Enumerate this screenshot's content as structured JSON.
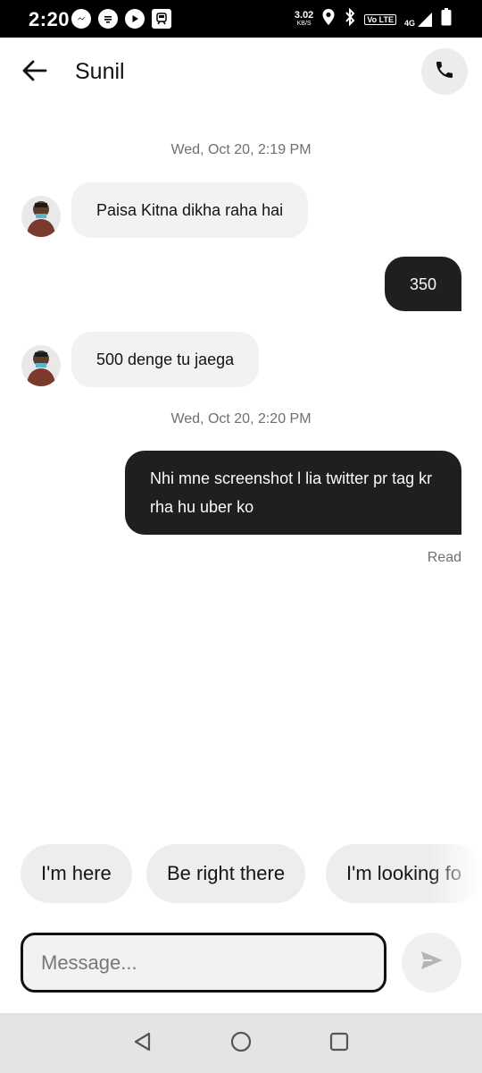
{
  "status_bar": {
    "time": "2:20",
    "speed": "3.02",
    "speed_unit": "KB/S",
    "volte": "Vo LTE",
    "network": "4G",
    "icons": [
      "messenger-icon",
      "chat-icon",
      "play-icon",
      "train-icon",
      "location-icon",
      "bluetooth-icon",
      "volte-icon",
      "signal-icon",
      "battery-icon"
    ]
  },
  "header": {
    "title": "Sunil",
    "back_icon": "arrow-left-icon",
    "call_icon": "phone-icon"
  },
  "chat": {
    "timestamp_1": "Wed, Oct 20, 2:19 PM",
    "timestamp_2": "Wed, Oct 20, 2:20 PM",
    "messages": [
      {
        "direction": "in",
        "text": "Paisa Kitna dikha raha hai"
      },
      {
        "direction": "out",
        "text": "350"
      },
      {
        "direction": "in",
        "text": "500 denge tu jaega"
      },
      {
        "direction": "out",
        "text": "Nhi mne screenshot l lia twitter pr tag kr rha hu uber ko"
      }
    ],
    "read_receipt": "Read"
  },
  "quick_replies": [
    "I'm here",
    "Be right there",
    "I'm looking fo"
  ],
  "composer": {
    "placeholder": "Message...",
    "value": "",
    "send_icon": "send-icon"
  },
  "nav_bar": {
    "icons": [
      "back-triangle-icon",
      "home-circle-icon",
      "recents-square-icon"
    ]
  },
  "colors": {
    "outgoing_bubble": "#1f1f1f",
    "incoming_bubble": "#f2f2f2",
    "chip_bg": "#ededed",
    "muted_text": "#6f6f6f"
  }
}
